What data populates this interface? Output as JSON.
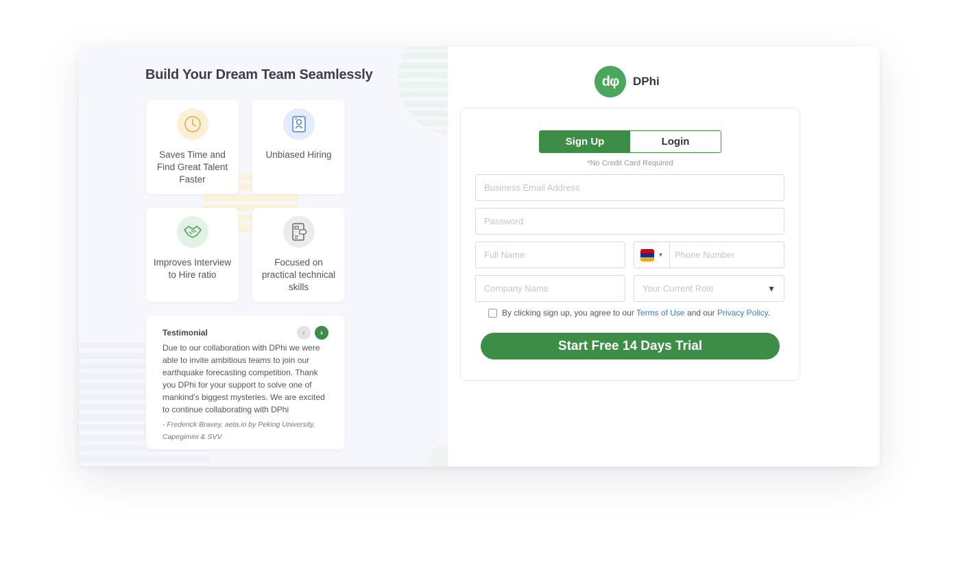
{
  "left": {
    "title": "Build Your Dream Team Seamlessly",
    "features": [
      {
        "label": "Saves Time and Find Great Talent Faster",
        "icon": "clock-icon"
      },
      {
        "label": "Unbiased Hiring",
        "icon": "resume-icon"
      },
      {
        "label": "Improves Interview to Hire ratio",
        "icon": "handshake-icon"
      },
      {
        "label": "Focused on practical technical skills",
        "icon": "skills-icon"
      }
    ],
    "testimonial": {
      "title": "Testimonial",
      "body": "Due to our collaboration with DPhi we were able to invite ambitious teams to join our earthquake forecasting competition. Thank you DPhi for your support to solve one of mankind's biggest mysteries. We are excited to continue collaborating with DPhi",
      "author": "- Frederick Bravey, aeta.io by Peking University, Capegimini & SVV",
      "prev_icon": "chevron-left-icon",
      "next_icon": "chevron-right-icon"
    }
  },
  "brand": {
    "logo_text": "dφ",
    "name": "DPhi"
  },
  "form": {
    "tabs": {
      "signup": "Sign Up",
      "login": "Login"
    },
    "no_credit_card": "*No Credit Card  Required",
    "email_placeholder": "Business Email Address",
    "password_placeholder": "Password",
    "full_name_placeholder": "Full Name",
    "phone_placeholder": "Phone Number",
    "company_placeholder": "Company Name",
    "role_placeholder": "Your Current Role",
    "agree": {
      "prefix": "By clicking sign up, you agree to our",
      "terms": "Terms of Use",
      "middle": "and our",
      "privacy": "Privacy Policy",
      "suffix": "."
    },
    "cta": "Start Free 14 Days Trial"
  },
  "colors": {
    "primary_green": "#3c8d46",
    "logo_green": "#48a75a",
    "link_blue": "#2f7fd6",
    "panel_bg": "#f5f7fc"
  }
}
